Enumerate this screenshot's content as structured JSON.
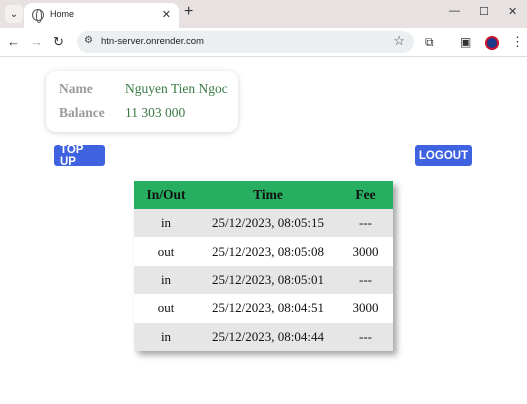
{
  "browser": {
    "tab_title": "Home",
    "tab_close": "✕",
    "new_tab": "+",
    "url": "htn-server.onrender.com",
    "window_controls": {
      "minimize": "—",
      "maximize": "☐",
      "close": "✕"
    }
  },
  "account": {
    "name_label": "Name",
    "name_value": "Nguyen Tien Ngoc",
    "balance_label": "Balance",
    "balance_value": "11 303 000"
  },
  "actions": {
    "topup_label": "TOP UP",
    "logout_label": "LOGOUT"
  },
  "history": {
    "headers": [
      "In/Out",
      "Time",
      "Fee"
    ],
    "rows": [
      {
        "direction": "in",
        "time": "25/12/2023, 08:05:15",
        "fee": "---"
      },
      {
        "direction": "out",
        "time": "25/12/2023, 08:05:08",
        "fee": "3000"
      },
      {
        "direction": "in",
        "time": "25/12/2023, 08:05:01",
        "fee": "---"
      },
      {
        "direction": "out",
        "time": "25/12/2023, 08:04:51",
        "fee": "3000"
      },
      {
        "direction": "in",
        "time": "25/12/2023, 08:04:44",
        "fee": "---"
      }
    ]
  },
  "colors": {
    "header_green": "#27ae60",
    "button_blue": "#3f63e0",
    "value_green": "#3a7a45"
  }
}
